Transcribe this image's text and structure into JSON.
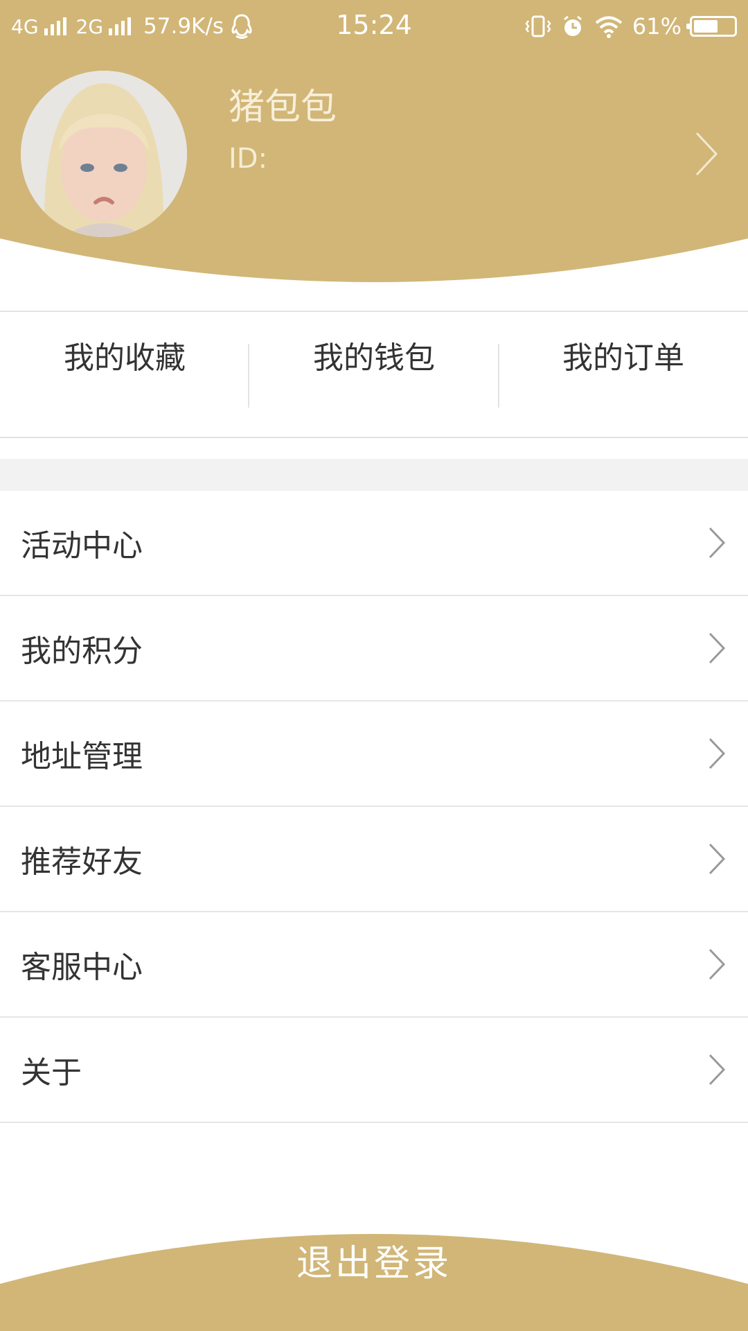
{
  "colors": {
    "accent": "#D1B677",
    "divider": "#E5E5E5",
    "section_band": "#F2F2F2",
    "chevron": "#999999"
  },
  "status_bar": {
    "network_1": "4G",
    "network_2": "2G",
    "speed": "57.9K/s",
    "time": "15:24",
    "battery": "61%",
    "battery_level": 0.61,
    "icons": [
      "qq-icon",
      "vibrate-icon",
      "alarm-icon",
      "wifi-icon",
      "battery-icon"
    ]
  },
  "profile": {
    "name": "猪包包",
    "id_label": "ID:",
    "avatar_icon": "avatar-photo"
  },
  "quick_actions": [
    {
      "label": "我的收藏"
    },
    {
      "label": "我的钱包"
    },
    {
      "label": "我的订单"
    }
  ],
  "menu": [
    {
      "label": "活动中心"
    },
    {
      "label": "我的积分"
    },
    {
      "label": "地址管理"
    },
    {
      "label": "推荐好友"
    },
    {
      "label": "客服中心"
    },
    {
      "label": "关于"
    }
  ],
  "logout": {
    "label": "退出登录"
  }
}
